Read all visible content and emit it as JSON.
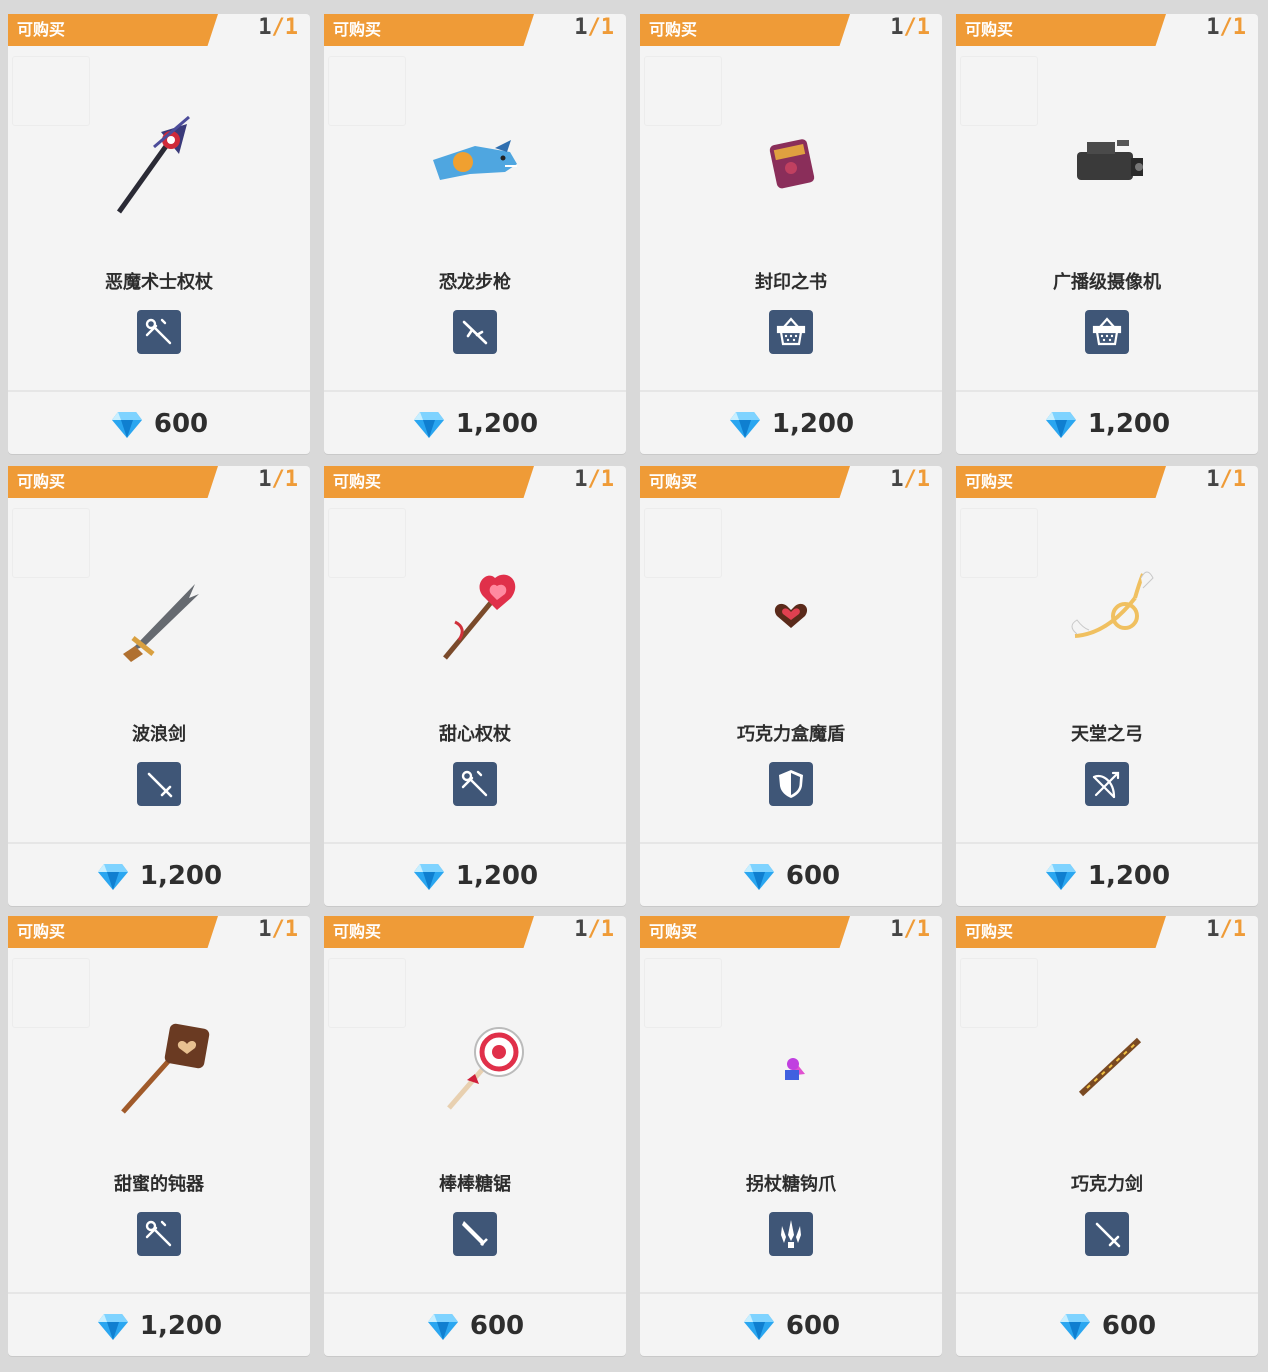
{
  "badge_label": "可购买",
  "items": [
    {
      "name": "恶魔术士权杖",
      "count": "1",
      "max": "1",
      "price": "600",
      "type": "staff-icon",
      "art": "demon-staff"
    },
    {
      "name": "恐龙步枪",
      "count": "1",
      "max": "1",
      "price": "1,200",
      "type": "rifle-icon",
      "art": "dino-rifle"
    },
    {
      "name": "封印之书",
      "count": "1",
      "max": "1",
      "price": "1,200",
      "type": "basket-icon",
      "art": "sealed-book"
    },
    {
      "name": "广播级摄像机",
      "count": "1",
      "max": "1",
      "price": "1,200",
      "type": "basket-icon",
      "art": "camera"
    },
    {
      "name": "波浪剑",
      "count": "1",
      "max": "1",
      "price": "1,200",
      "type": "sword-icon",
      "art": "wave-sword"
    },
    {
      "name": "甜心权杖",
      "count": "1",
      "max": "1",
      "price": "1,200",
      "type": "staff-icon",
      "art": "heart-staff"
    },
    {
      "name": "巧克力盒魔盾",
      "count": "1",
      "max": "1",
      "price": "600",
      "type": "shield-icon",
      "art": "choco-shield"
    },
    {
      "name": "天堂之弓",
      "count": "1",
      "max": "1",
      "price": "1,200",
      "type": "bow-icon",
      "art": "heaven-bow"
    },
    {
      "name": "甜蜜的钝器",
      "count": "1",
      "max": "1",
      "price": "1,200",
      "type": "staff-icon",
      "art": "sweet-mace"
    },
    {
      "name": "棒棒糖锯",
      "count": "1",
      "max": "1",
      "price": "600",
      "type": "blade-icon",
      "art": "lollipop-saw"
    },
    {
      "name": "拐杖糖钩爪",
      "count": "1",
      "max": "1",
      "price": "600",
      "type": "claw-icon",
      "art": "candy-claw"
    },
    {
      "name": "巧克力剑",
      "count": "1",
      "max": "1",
      "price": "600",
      "type": "sword-icon",
      "art": "choco-sword"
    }
  ],
  "colors": {
    "badge": "#ef9b37",
    "type_bg": "#3f5677",
    "gem": "#2aa6f0"
  }
}
